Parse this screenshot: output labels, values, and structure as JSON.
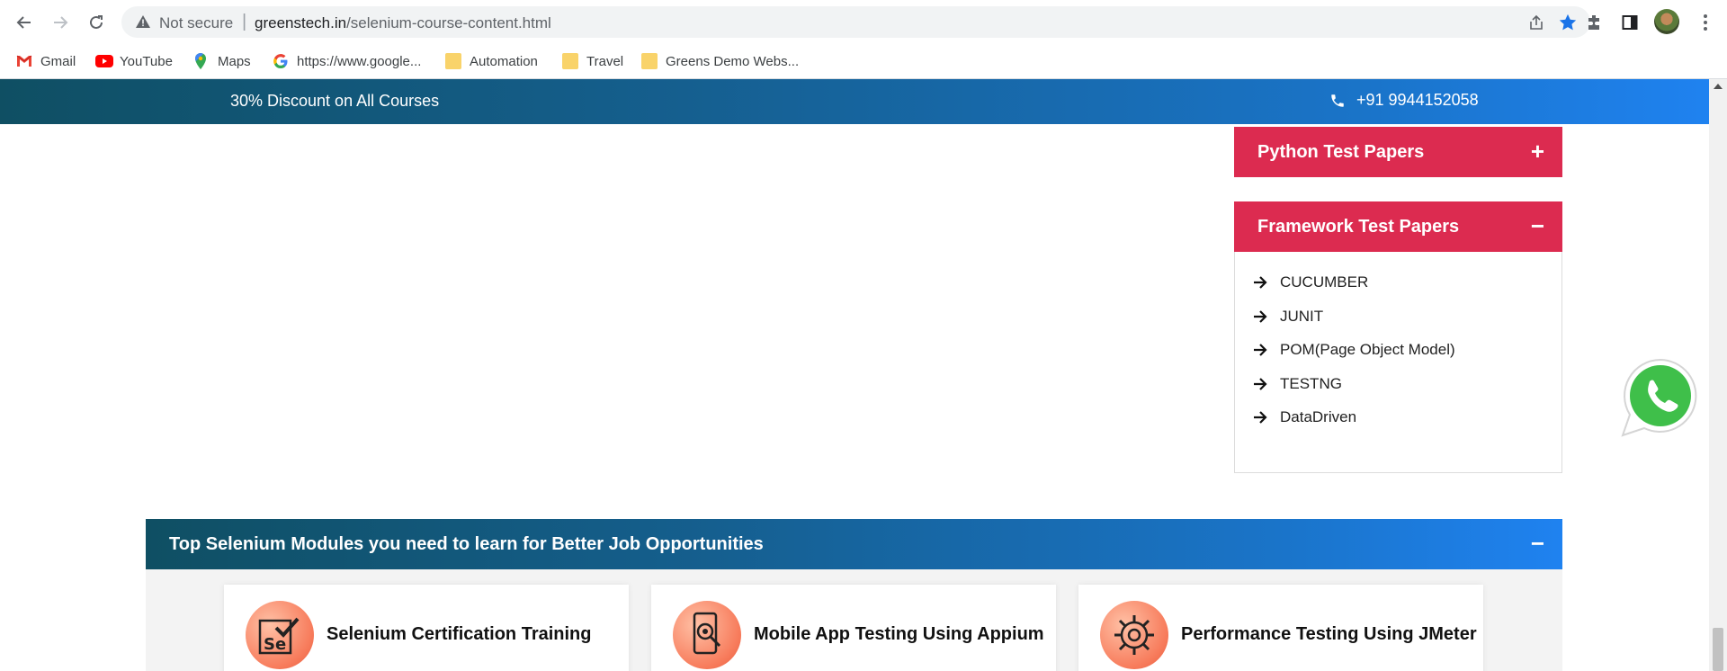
{
  "browser": {
    "security_label": "Not secure",
    "url_domain": "greenstech.in",
    "url_path": "/selenium-course-content.html",
    "bookmarks": [
      {
        "label": "Gmail",
        "icon": "gmail-icon"
      },
      {
        "label": "YouTube",
        "icon": "youtube-icon"
      },
      {
        "label": "Maps",
        "icon": "maps-icon"
      },
      {
        "label": "https://www.google...",
        "icon": "google-icon"
      },
      {
        "label": "Automation",
        "icon": "folder-icon"
      },
      {
        "label": "Travel",
        "icon": "folder-icon"
      },
      {
        "label": "Greens Demo Webs...",
        "icon": "folder-icon"
      }
    ]
  },
  "topbar": {
    "discount": "30% Discount on All Courses",
    "phone": "+91 9944152058"
  },
  "sidebar": {
    "python_papers": {
      "title": "Python Test Papers",
      "sign": "+"
    },
    "framework_papers": {
      "title": "Framework Test Papers",
      "sign": "−",
      "items": [
        "CUCUMBER",
        "JUNIT",
        "POM(Page Object Model)",
        "TESTNG",
        "DataDriven"
      ]
    }
  },
  "modules": {
    "title": "Top Selenium Modules you need to learn for Better Job Opportunities",
    "sign": "−",
    "cards": [
      {
        "title": "Selenium Certification Training",
        "icon": "selenium-icon"
      },
      {
        "title": "Mobile App Testing Using Appium",
        "icon": "mobile-testing-icon"
      },
      {
        "title": "Performance Testing Using JMeter",
        "icon": "performance-gear-icon"
      }
    ]
  },
  "colors": {
    "accordion_red": "#dc2b50",
    "bar_gradient_start": "#0f4f63",
    "bar_gradient_end": "#1f82f0"
  }
}
